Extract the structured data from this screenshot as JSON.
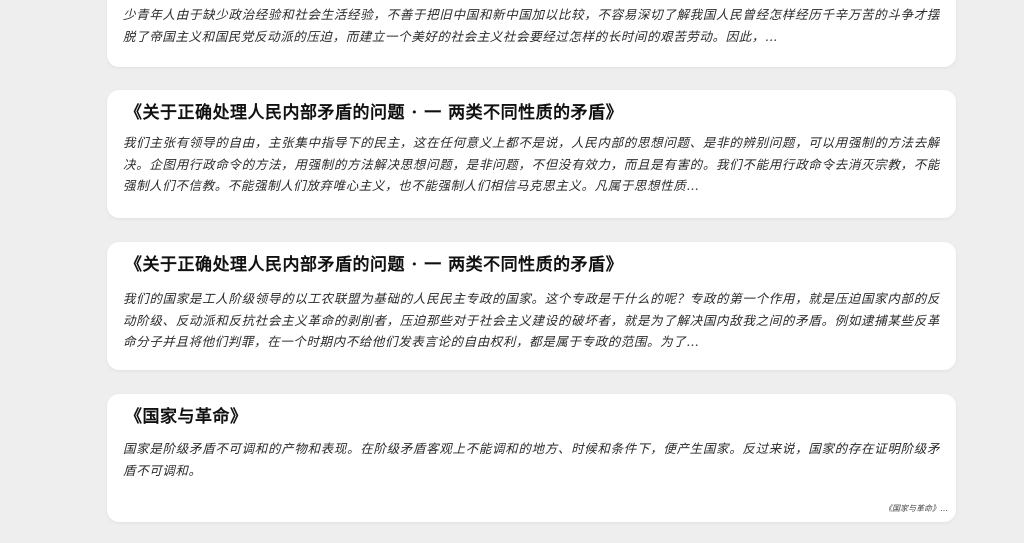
{
  "cards": [
    {
      "title": "",
      "body": "少青年人由于缺少政治经验和社会生活经验，不善于把旧中国和新中国加以比较，不容易深切了解我国人民曾经怎样经历千辛万苦的斗争才摆脱了帝国主义和国民党反动派的压迫，而建立一个美好的社会主义社会要经过怎样的长时间的艰苦劳动。因此，…"
    },
    {
      "title": "《关于正确处理人民内部矛盾的问题 · 一 两类不同性质的矛盾》",
      "body": "我们主张有领导的自由，主张集中指导下的民主，这在任何意义上都不是说，人民内部的思想问题、是非的辨别问题，可以用强制的方法去解决。企图用行政命令的方法，用强制的方法解决思想问题，是非问题，不但没有效力，而且是有害的。我们不能用行政命令去消灭宗教，不能强制人们不信教。不能强制人们放弃唯心主义，也不能强制人们相信马克思主义。凡属于思想性质…"
    },
    {
      "title": "《关于正确处理人民内部矛盾的问题 · 一 两类不同性质的矛盾》",
      "body": "我们的国家是工人阶级领导的以工农联盟为基础的人民民主专政的国家。这个专政是干什么的呢？专政的第一个作用，就是压迫国家内部的反动阶级、反动派和反抗社会主义革命的剥削者，压迫那些对于社会主义建设的破坏者，就是为了解决国内敌我之间的矛盾。例如逮捕某些反革命分子并且将他们判罪，在一个时期内不给他们发表言论的自由权利，都是属于专政的范围。为了…"
    },
    {
      "title": "《国家与革命》",
      "body": "国家是阶级矛盾不可调和的产物和表现。在阶级矛盾客观上不能调和的地方、时候和条件下，便产生国家。反过来说，国家的存在证明阶级矛盾不可调和。",
      "source": "《国家与革命》…"
    }
  ]
}
